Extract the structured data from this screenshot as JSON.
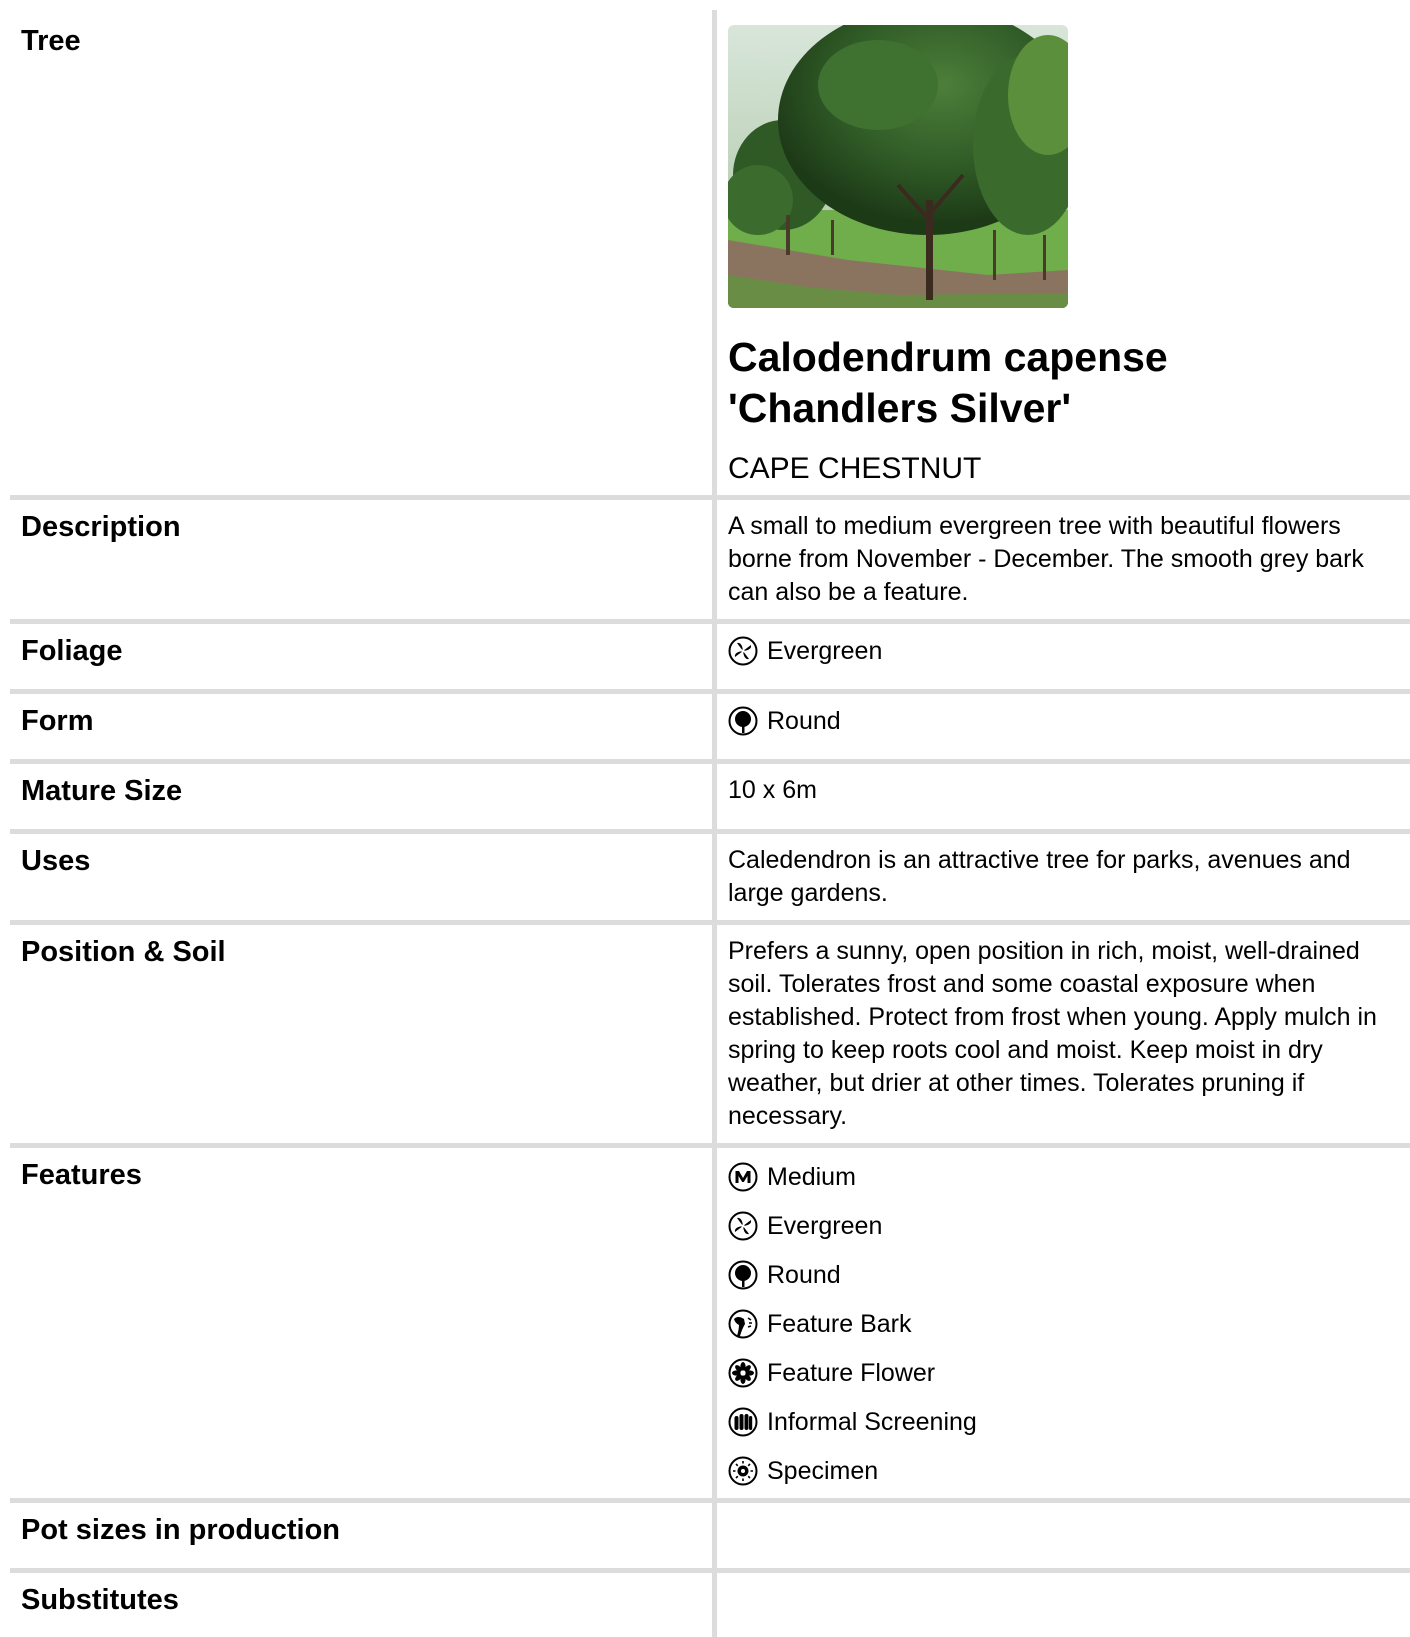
{
  "tree": {
    "label": "Tree",
    "botanical_name_line1": "Calodendrum capense",
    "botanical_name_line2": "'Chandlers Silver'",
    "common_name": "CAPE CHESTNUT"
  },
  "description": {
    "label": "Description",
    "text": "A small to medium evergreen tree with beautiful flowers borne from November - December. The smooth grey bark can also be a feature."
  },
  "foliage": {
    "label": "Foliage",
    "value": "Evergreen",
    "icon": "evergreen-leaves-icon"
  },
  "form": {
    "label": "Form",
    "value": "Round",
    "icon": "round-tree-icon"
  },
  "mature_size": {
    "label": "Mature Size",
    "value": "10 x 6m"
  },
  "uses": {
    "label": "Uses",
    "text": "Caledendron is an attractive tree for parks, avenues and large gardens."
  },
  "position_soil": {
    "label": "Position & Soil",
    "text": "Prefers a sunny, open position in rich, moist, well-drained soil. Tolerates frost and some coastal exposure when established. Protect from frost when young. Apply mulch in spring to keep roots cool and moist. Keep moist in dry weather, but drier at other times. Tolerates pruning if necessary."
  },
  "features": {
    "label": "Features",
    "items": [
      {
        "label": "Medium",
        "icon": "medium-m-icon"
      },
      {
        "label": "Evergreen",
        "icon": "evergreen-leaves-icon"
      },
      {
        "label": "Round",
        "icon": "round-tree-icon"
      },
      {
        "label": "Feature Bark",
        "icon": "feature-bark-icon"
      },
      {
        "label": "Feature Flower",
        "icon": "feature-flower-icon"
      },
      {
        "label": "Informal Screening",
        "icon": "informal-screening-icon"
      },
      {
        "label": "Specimen",
        "icon": "specimen-icon"
      }
    ]
  },
  "pot_sizes": {
    "label": "Pot sizes in production",
    "value": ""
  },
  "substitutes": {
    "label": "Substitutes",
    "value": ""
  },
  "colors": {
    "border": "#dcdcdc",
    "text": "#000000",
    "background": "#ffffff"
  }
}
